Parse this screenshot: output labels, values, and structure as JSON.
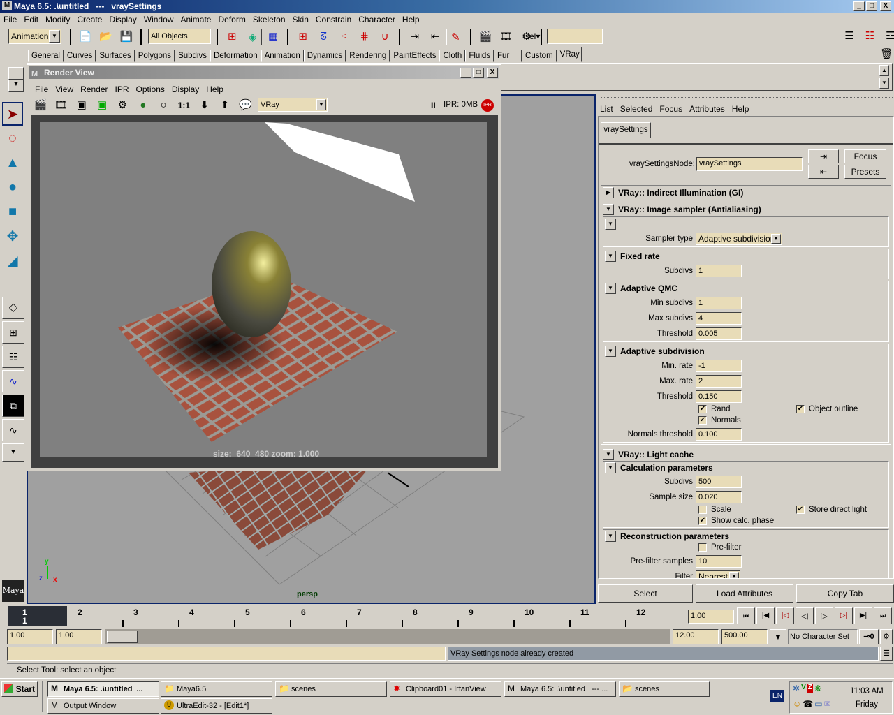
{
  "app": {
    "title": "Maya 6.5: .\\untitled   ---   vraySettings",
    "win_min": "_",
    "win_max": "□",
    "win_close": "X"
  },
  "menu": [
    "File",
    "Edit",
    "Modify",
    "Create",
    "Display",
    "Window",
    "Animate",
    "Deform",
    "Skeleton",
    "Skin",
    "Constrain",
    "Character",
    "Help"
  ],
  "statusline": {
    "menu_set": "Animation",
    "selection_mask": "All Objects",
    "sel_label": "sel▾",
    "sel_field": ""
  },
  "shelf": {
    "tabs": [
      "General",
      "Curves",
      "Surfaces",
      "Polygons",
      "Subdivs",
      "Deformation",
      "Animation",
      "Dynamics",
      "Rendering",
      "PaintEffects",
      "Cloth",
      "Fluids",
      "Fur",
      "Custom",
      "VRay"
    ],
    "active_tab": "VRay"
  },
  "render_view": {
    "title": "Render View",
    "menu": [
      "File",
      "View",
      "Render",
      "IPR",
      "Options",
      "Display",
      "Help"
    ],
    "one_to_one": "1:1",
    "renderer": "VRay",
    "ipr_status": "IPR: 0MB",
    "pause_icon": "II",
    "ipr_badge": "IPR",
    "size_info": "size:  640  480 zoom: 1.000"
  },
  "viewport": {
    "camera": "persp",
    "axis_x": "x",
    "axis_y": "y",
    "axis_z": "z",
    "logo": "Maya"
  },
  "attribute_editor": {
    "menu": [
      "List",
      "Selected",
      "Focus",
      "Attributes",
      "Help"
    ],
    "tab": "vraySettings",
    "node_label": "vraySettingsNode:",
    "node_value": "vraySettings",
    "focus_button": "Focus",
    "presets_button": "Presets",
    "sections": {
      "gi": "VRay:: Indirect Illumination (GI)",
      "sampler": "VRay:: Image sampler (Antialiasing)",
      "sampler_type_label": "Sampler type",
      "sampler_type_value": "Adaptive subdivision",
      "fixed_rate": "Fixed rate",
      "fixed_subdivs_label": "Subdivs",
      "fixed_subdivs": "1",
      "adaptive_qmc": "Adaptive QMC",
      "qmc_min_label": "Min subdivs",
      "qmc_min": "1",
      "qmc_max_label": "Max subdivs",
      "qmc_max": "4",
      "qmc_thresh_label": "Threshold",
      "qmc_thresh": "0.005",
      "adaptive_subdiv": "Adaptive subdivision",
      "as_min_label": "Min. rate",
      "as_min": "-1",
      "as_max_label": "Max. rate",
      "as_max": "2",
      "as_thresh_label": "Threshold",
      "as_thresh": "0.150",
      "rand_label": "Rand",
      "rand_checked": true,
      "outline_label": "Object outline",
      "outline_checked": true,
      "normals_label": "Normals",
      "normals_checked": true,
      "normals_thresh_label": "Normals threshold",
      "normals_thresh": "0.100",
      "light_cache": "VRay:: Light cache",
      "calc_params": "Calculation parameters",
      "lc_subdivs_label": "Subdivs",
      "lc_subdivs": "500",
      "lc_sample_label": "Sample size",
      "lc_sample": "0.020",
      "scale_label": "Scale",
      "scale_checked": false,
      "store_label": "Store direct light",
      "store_checked": true,
      "show_calc_label": "Show calc. phase",
      "show_calc_checked": true,
      "recon_params": "Reconstruction parameters",
      "prefilter_label": "Pre-filter",
      "prefilter_checked": false,
      "prefilter_samples_label": "Pre-filter samples",
      "prefilter_samples": "10",
      "filter_label": "Filter",
      "filter_value": "Nearest"
    },
    "select_button": "Select",
    "load_button": "Load Attributes",
    "copy_button": "Copy Tab",
    "check_mark": "✔"
  },
  "timeline": {
    "ticks": [
      "1",
      "2",
      "3",
      "4",
      "5",
      "6",
      "7",
      "8",
      "9",
      "10",
      "11",
      "12"
    ],
    "current_frame": "1",
    "current_field": "1.00"
  },
  "range": {
    "start": "1.00",
    "playback_start": "1.00",
    "playback_end": "12.00",
    "end": "500.00",
    "character_set": "No Character Set"
  },
  "command_line": {
    "input": "",
    "result": "VRay Settings node already created"
  },
  "help_line": "Select Tool: select an object",
  "taskbar": {
    "start": "Start",
    "tasks": [
      {
        "label": "Maya 6.5: .\\untitled  ...",
        "icon": "M",
        "active": true
      },
      {
        "label": "Maya6.5",
        "icon": "📁"
      },
      {
        "label": "scenes",
        "icon": "📁"
      },
      {
        "label": "Clipboard01 - IrfanView",
        "icon": "✹"
      },
      {
        "label": "Maya 6.5: .\\untitled   --- ...",
        "icon": "M"
      },
      {
        "label": "scenes",
        "icon": "📂"
      },
      {
        "label": "Output Window",
        "icon": "M"
      },
      {
        "label": "UltraEdit-32 - [Edit1*]",
        "icon": "U"
      }
    ],
    "lang": "EN",
    "time": "11:03 AM",
    "day": "Friday"
  }
}
